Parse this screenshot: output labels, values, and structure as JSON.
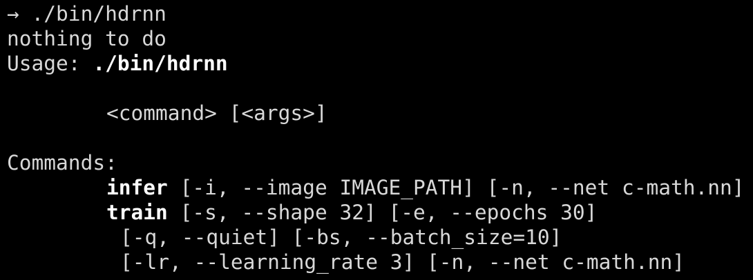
{
  "terminal": {
    "prompt_symbol": "→",
    "command": " ./bin/hdrnn",
    "message": "nothing to do",
    "usage_label": "Usage: ",
    "usage_binary": "./bin/hdrnn",
    "usage_args": "<command> [<args>]",
    "commands_heading": "Commands:",
    "commands": [
      {
        "name": "infer",
        "args": " [-i, --image IMAGE_PATH] [-n, --net c-math.nn]"
      },
      {
        "name": "train",
        "args": " [-s, --shape 32] [-e, --epochs 30]"
      }
    ],
    "train_continuation": [
      "[-q, --quiet] [-bs, --batch_size=10]",
      "[-lr, --learning_rate 3] [-n, --net c-math.nn]"
    ]
  }
}
